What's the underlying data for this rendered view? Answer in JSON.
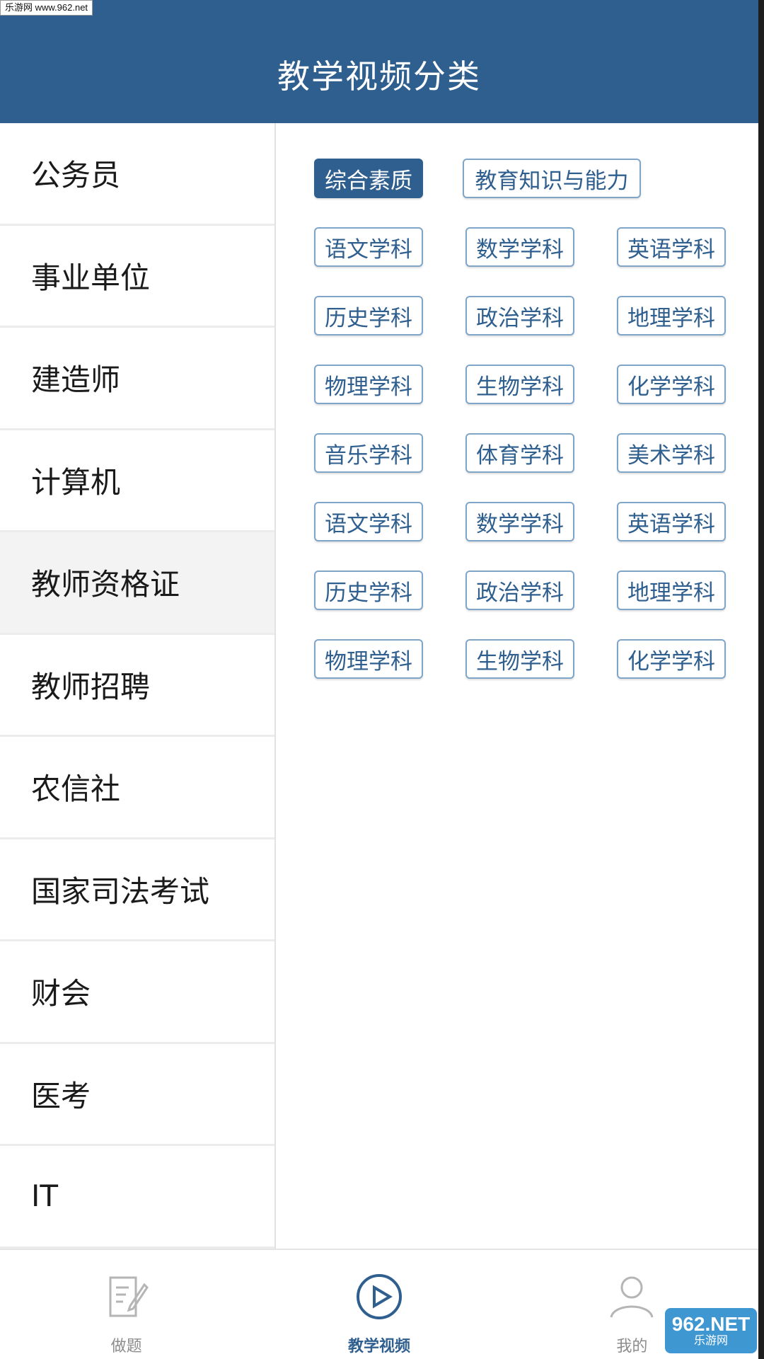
{
  "watermark": {
    "top_left": "乐游网 www.962.net",
    "bottom_right_big": "962.NET",
    "bottom_right_small": "乐游网"
  },
  "header": {
    "title": "教学视频分类"
  },
  "sidebar": {
    "items": [
      {
        "label": "公务员",
        "active": false
      },
      {
        "label": "事业单位",
        "active": false
      },
      {
        "label": "建造师",
        "active": false
      },
      {
        "label": "计算机",
        "active": false
      },
      {
        "label": "教师资格证",
        "active": true
      },
      {
        "label": "教师招聘",
        "active": false
      },
      {
        "label": "农信社",
        "active": false
      },
      {
        "label": "国家司法考试",
        "active": false
      },
      {
        "label": "财会",
        "active": false
      },
      {
        "label": "医考",
        "active": false
      },
      {
        "label": "IT",
        "active": false
      }
    ]
  },
  "tags": {
    "top_row": [
      {
        "label": "综合素质",
        "selected": true
      },
      {
        "label": "教育知识与能力",
        "selected": false
      }
    ],
    "rows": [
      [
        "语文学科",
        "数学学科",
        "英语学科"
      ],
      [
        "历史学科",
        "政治学科",
        "地理学科"
      ],
      [
        "物理学科",
        "生物学科",
        "化学学科"
      ],
      [
        "音乐学科",
        "体育学科",
        "美术学科"
      ],
      [
        "语文学科",
        "数学学科",
        "英语学科"
      ],
      [
        "历史学科",
        "政治学科",
        "地理学科"
      ],
      [
        "物理学科",
        "生物学科",
        "化学学科"
      ]
    ]
  },
  "bottom_nav": {
    "items": [
      {
        "label": "做题",
        "icon": "edit-icon",
        "active": false
      },
      {
        "label": "教学视频",
        "icon": "play-circle-icon",
        "active": true
      },
      {
        "label": "我的",
        "icon": "user-icon",
        "active": false
      }
    ]
  },
  "colors": {
    "primary": "#2f5f8f",
    "tag_border": "#7fa5c9",
    "active_row_bg": "#f3f3f3"
  }
}
